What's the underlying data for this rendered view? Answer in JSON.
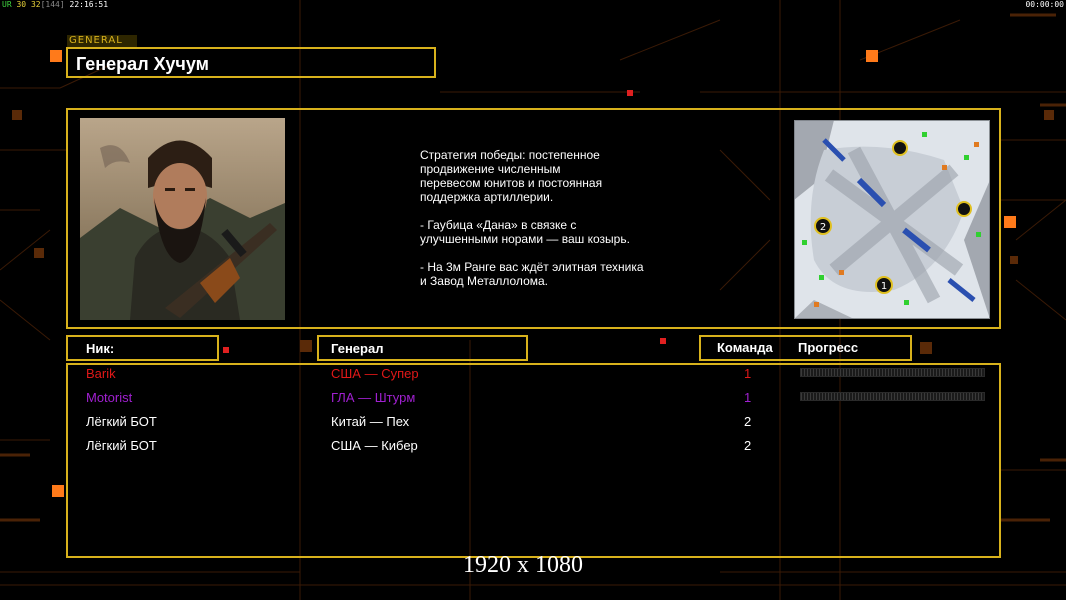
{
  "hud": {
    "left_a": "UR",
    "left_b": "30",
    "left_c": "32",
    "left_d": "[144]",
    "left_time": "22:16:51",
    "right_time": "00:00:00"
  },
  "general_tag": "GENERAL",
  "general_name": "Генерал Хучум",
  "description": [
    "Стратегия победы: постепенное\nпродвижение численным\nперевесом юнитов и постоянная\nподдержка артиллерии.",
    "- Гаубица «Дана» в связке с\nулучшенными норами — ваш козырь.",
    "- На 3м Ранге вас ждёт элитная техника\nи Завод Металлолома."
  ],
  "map_markers": [
    "1",
    "2"
  ],
  "headers": {
    "nick": "Ник:",
    "general": "Генерал",
    "team": "Команда",
    "progress": "Прогресс"
  },
  "players": [
    {
      "nick": "Barik",
      "general": "США — Супер",
      "team": "1",
      "color": "#e01818",
      "progress": 0
    },
    {
      "nick": "Motorist",
      "general": "ГЛА — Штурм",
      "team": "1",
      "color": "#a020d0",
      "progress": 0
    },
    {
      "nick": "Лёгкий БОТ",
      "general": "Китай — Пех",
      "team": "2",
      "color": "#ffffff"
    },
    {
      "nick": "Лёгкий БОТ",
      "general": "США — Кибер",
      "team": "2",
      "color": "#ffffff"
    }
  ],
  "resolution": "1920 x 1080",
  "colors": {
    "frame": "#d8b21c",
    "accent": "#ff7a1a"
  }
}
